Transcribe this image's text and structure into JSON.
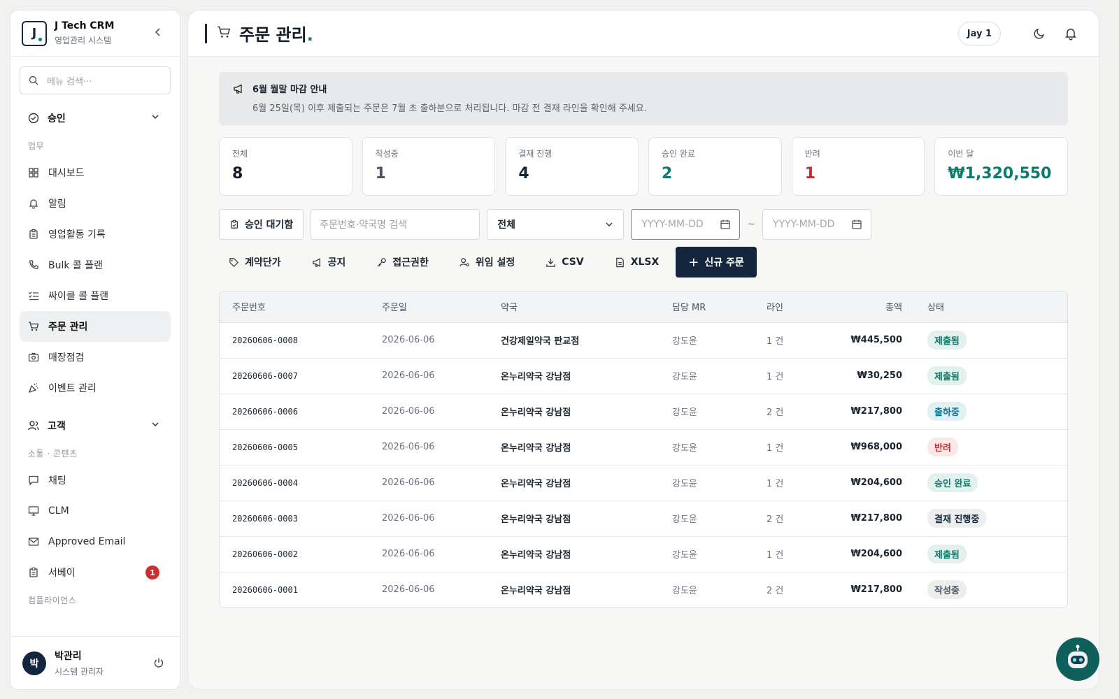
{
  "sidebar": {
    "brand_logo": "J",
    "brand_title": "J Tech CRM",
    "brand_subtitle": "영업관리 시스템",
    "search_placeholder": "메뉴 검색···",
    "group_approval": "승인",
    "section_work": "업무",
    "work_items": [
      {
        "label": "대시보드",
        "icon": "dashboard-icon"
      },
      {
        "label": "알림",
        "icon": "bell-icon"
      },
      {
        "label": "영업활동 기록",
        "icon": "clipboard-icon"
      },
      {
        "label": "Bulk 콜 플랜",
        "icon": "phone-icon"
      },
      {
        "label": "싸이클 콜 플랜",
        "icon": "checklist-icon"
      },
      {
        "label": "주문 관리",
        "icon": "cart-icon",
        "active": true
      },
      {
        "label": "매장점검",
        "icon": "camera-icon"
      },
      {
        "label": "이벤트 관리",
        "icon": "party-icon"
      }
    ],
    "group_customer": "고객",
    "section_comm": "소통 · 콘텐츠",
    "comm_items": [
      {
        "label": "채팅",
        "icon": "chat-icon"
      },
      {
        "label": "CLM",
        "icon": "presentation-icon"
      },
      {
        "label": "Approved Email",
        "icon": "mail-icon"
      },
      {
        "label": "서베이",
        "icon": "survey-icon",
        "badge": "1"
      }
    ],
    "section_compliance": "컴플라이언스",
    "user": {
      "initial": "박",
      "name": "박관리",
      "role": "시스템 관리자"
    }
  },
  "header": {
    "title": "주문 관리",
    "title_dot": ".",
    "user_chip": "Jay 1"
  },
  "notice": {
    "title": "6월 월말 마감 안내",
    "body": "6월 25일(목) 이후 제출되는 주문은 7월 초 출하분으로 처리됩니다. 마감 전 결재 라인을 확인해 주세요."
  },
  "stats": [
    {
      "label": "전체",
      "value": "8",
      "color": "#111827"
    },
    {
      "label": "작성중",
      "value": "1",
      "color": "#4b5563"
    },
    {
      "label": "결재 진행",
      "value": "4",
      "color": "#13263d"
    },
    {
      "label": "승인 완료",
      "value": "2",
      "color": "#0f7a6b"
    },
    {
      "label": "반려",
      "value": "1",
      "color": "#c62f2f"
    },
    {
      "label": "이번 달",
      "value": "₩1,320,550",
      "color": "#0f7a6b"
    }
  ],
  "filters": {
    "pending_button": "승인 대기함",
    "search_placeholder": "주문번호·약국명 검색",
    "status_select": "전체",
    "date_from_placeholder": "YYYY-MM-DD",
    "date_to_placeholder": "YYYY-MM-DD",
    "range_separator": "~"
  },
  "actions": {
    "contract_price": "계약단가",
    "notice": "공지",
    "access": "접근권한",
    "delegate": "위임 설정",
    "csv": "CSV",
    "xlsx": "XLSX",
    "new_order": "신규 주문"
  },
  "table": {
    "columns": [
      "주문번호",
      "주문일",
      "약국",
      "담당 MR",
      "라인",
      "총액",
      "상태"
    ],
    "rows": [
      {
        "order_no": "20260606-0008",
        "date": "2026-06-06",
        "pharmacy": "건강제일약국 판교점",
        "mr": "강도윤",
        "lines": "1 건",
        "total": "₩445,500",
        "status": "제출됨",
        "status_type": "submitted"
      },
      {
        "order_no": "20260606-0007",
        "date": "2026-06-06",
        "pharmacy": "온누리약국 강남점",
        "mr": "강도윤",
        "lines": "1 건",
        "total": "₩30,250",
        "status": "제출됨",
        "status_type": "submitted"
      },
      {
        "order_no": "20260606-0006",
        "date": "2026-06-06",
        "pharmacy": "온누리약국 강남점",
        "mr": "강도윤",
        "lines": "2 건",
        "total": "₩217,800",
        "status": "출하중",
        "status_type": "shipping"
      },
      {
        "order_no": "20260606-0005",
        "date": "2026-06-06",
        "pharmacy": "온누리약국 강남점",
        "mr": "강도윤",
        "lines": "1 건",
        "total": "₩968,000",
        "status": "반려",
        "status_type": "rejected"
      },
      {
        "order_no": "20260606-0004",
        "date": "2026-06-06",
        "pharmacy": "온누리약국 강남점",
        "mr": "강도윤",
        "lines": "1 건",
        "total": "₩204,600",
        "status": "승인 완료",
        "status_type": "approved"
      },
      {
        "order_no": "20260606-0003",
        "date": "2026-06-06",
        "pharmacy": "온누리약국 강남점",
        "mr": "강도윤",
        "lines": "2 건",
        "total": "₩217,800",
        "status": "결재 진행중",
        "status_type": "inprogress"
      },
      {
        "order_no": "20260606-0002",
        "date": "2026-06-06",
        "pharmacy": "온누리약국 강남점",
        "mr": "강도윤",
        "lines": "1 건",
        "total": "₩204,600",
        "status": "제출됨",
        "status_type": "submitted"
      },
      {
        "order_no": "20260606-0001",
        "date": "2026-06-06",
        "pharmacy": "온누리약국 강남점",
        "mr": "강도윤",
        "lines": "2 건",
        "total": "₩217,800",
        "status": "작성중",
        "status_type": "draft"
      }
    ]
  },
  "status_colors": {
    "submitted": {
      "bg": "#e3f1ee",
      "fg": "#0f7a6b"
    },
    "shipping": {
      "bg": "#dff1f4",
      "fg": "#0e7490"
    },
    "rejected": {
      "bg": "#fbe7e7",
      "fg": "#c62f2f"
    },
    "approved": {
      "bg": "#e3f1ee",
      "fg": "#0f7a6b"
    },
    "inprogress": {
      "bg": "#eceef0",
      "fg": "#13263d"
    },
    "draft": {
      "bg": "#eceeec",
      "fg": "#4b5563"
    }
  }
}
